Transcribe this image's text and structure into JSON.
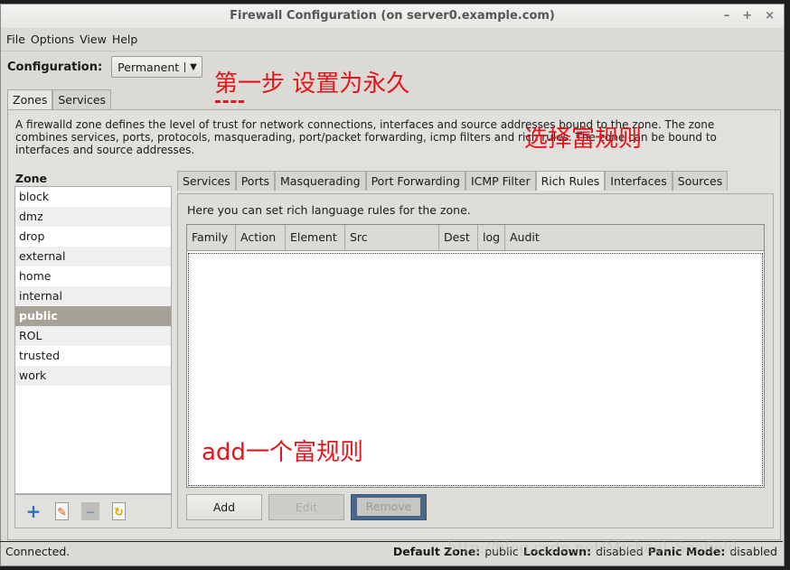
{
  "window": {
    "title": "Firewall Configuration (on server0.example.com)",
    "controls": [
      "–",
      "+",
      "×"
    ]
  },
  "menu": [
    "File",
    "Options",
    "View",
    "Help"
  ],
  "config": {
    "label": "Configuration:",
    "value": "Permanent"
  },
  "top_tabs": [
    "Zones",
    "Services"
  ],
  "description": "A firewalld zone defines the level of trust for network connections, interfaces and source addresses bound to the zone. The zone combines services, ports, protocols, masquerading, port/packet forwarding, icmp filters and rich rules. The zone can be bound to interfaces and source addresses.",
  "zone_label": "Zone",
  "zones": [
    "block",
    "dmz",
    "drop",
    "external",
    "home",
    "internal",
    "public",
    "ROL",
    "trusted",
    "work"
  ],
  "selected_zone": "public",
  "zone_tools": [
    "add-icon",
    "edit-icon",
    "remove-icon",
    "load-defaults-icon"
  ],
  "zone_tabs": [
    "Services",
    "Ports",
    "Masquerading",
    "Port Forwarding",
    "ICMP Filter",
    "Rich Rules",
    "Interfaces",
    "Sources"
  ],
  "active_zone_tab": "Rich Rules",
  "rich": {
    "text": "Here you can set rich language rules for the zone.",
    "columns": [
      "Family",
      "Action",
      "Element",
      "Src",
      "Dest",
      "log",
      "Audit"
    ],
    "add": "Add",
    "edit": "Edit",
    "remove": "Remove"
  },
  "status": {
    "left": "Connected.",
    "default_zone_label": "Default Zone:",
    "default_zone": "public",
    "lockdown_label": "Lockdown:",
    "lockdown": "disabled",
    "panic_label": "Panic Mode:",
    "panic": "disabled"
  },
  "annotations": {
    "a1": "第一步 设置为永久",
    "a2": "选择富规则",
    "a3": "add一个富规则"
  },
  "watermark": "http://blog.csdn.net/Michael_Scofield",
  "colors": {
    "annotation": "#e8141c",
    "selected": "#a6a297",
    "remove_button": "#4a6787"
  }
}
